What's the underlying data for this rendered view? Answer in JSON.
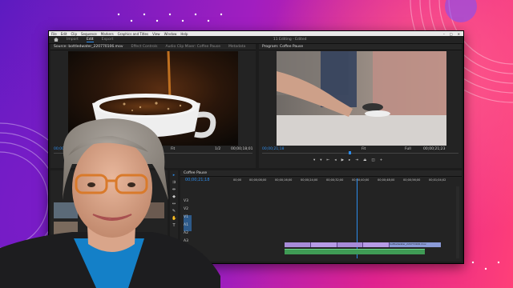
{
  "menu": {
    "items": [
      "File",
      "Edit",
      "Clip",
      "Sequence",
      "Markers",
      "Graphics and Titles",
      "View",
      "Window",
      "Help"
    ],
    "window_controls": [
      "–",
      "□",
      "✕"
    ]
  },
  "header": {
    "tabs": [
      "Import",
      "Edit",
      "Export"
    ],
    "active_tab": "Edit",
    "project": "11 Editing - Edited"
  },
  "source_panel": {
    "tabs": [
      "Source: bottledwater_220770106.mov",
      "Effect Controls",
      "Audio Clip Mixer: Coffee Pause",
      "Metadata"
    ],
    "timecode": "00;00;00;00",
    "fit": "Fit",
    "fraction": "1/2",
    "duration": "00;00;18;01"
  },
  "program_panel": {
    "tab": "Program: Coffee Pause",
    "timecode": "00;00;21;18",
    "fit": "Fit",
    "fraction": "Full",
    "duration": "00;00;21;23"
  },
  "timeline": {
    "tab": "Coffee Pause",
    "timecode": "00;00;21;18",
    "ruler": [
      "00;00",
      "00;00;08;00",
      "00;00;16;00",
      "00;00;24;00",
      "00;00;32;00",
      "00;00;40;00",
      "00;00;48;00",
      "00;00;56;00",
      "00;01;04;02"
    ],
    "tracks": [
      "V3",
      "V2",
      "V1",
      "A1",
      "A2",
      "A3"
    ],
    "clip_label": "bottledwater_220770106.mov"
  },
  "colors": {
    "accent_blue": "#2d8ceb",
    "clip_video": "#a78bd8",
    "clip_audio": "#3f9b55"
  }
}
